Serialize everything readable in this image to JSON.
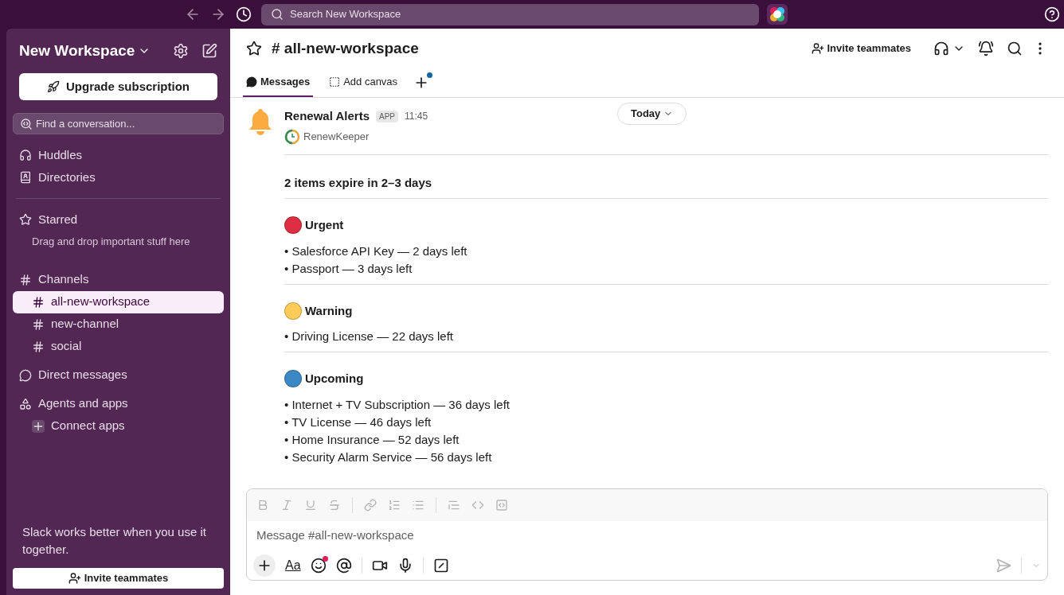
{
  "topbar": {
    "search_placeholder": "Search New Workspace"
  },
  "sidebar": {
    "workspace": "New Workspace",
    "upgrade_button": "Upgrade subscription",
    "search_placeholder": "Find a conversation...",
    "nav": [
      {
        "kind": "huddles",
        "label": "Huddles"
      },
      {
        "kind": "directories",
        "label": "Directories"
      }
    ],
    "starred": {
      "label": "Starred",
      "hint": "Drag and drop important stuff here"
    },
    "channels": {
      "label": "Channels",
      "items": [
        {
          "name": "all-new-workspace",
          "selected": true
        },
        {
          "name": "new-channel",
          "selected": false
        },
        {
          "name": "social",
          "selected": false
        }
      ]
    },
    "direct_messages": "Direct messages",
    "agents": {
      "label": "Agents and apps",
      "connect": "Connect apps"
    },
    "footer_text": "Slack works better when you use it together.",
    "invite_button": "Invite teammates"
  },
  "header": {
    "title": "# all-new-workspace",
    "invite_button": "Invite teammates",
    "tabs": [
      {
        "kind": "messages",
        "label": "Messages",
        "selected": true
      },
      {
        "kind": "canvas",
        "label": "Add canvas",
        "selected": false
      }
    ]
  },
  "date_pill": "Today",
  "message": {
    "sender": "Renewal Alerts",
    "badge": "APP",
    "time": "11:45",
    "app_name": "RenewKeeper",
    "heading": "2 items expire in 2–3 days",
    "groups": [
      {
        "title": "Urgent",
        "color": "#dd2e44",
        "items": [
          "• Salesforce API Key — 2 days left",
          "• Passport — 3 days left"
        ]
      },
      {
        "title": "Warning",
        "color": "#fdcb58",
        "items": [
          "• Driving License — 22 days left"
        ]
      },
      {
        "title": "Upcoming",
        "color": "#3b88c3",
        "items": [
          "• Internet + TV Subscription — 36 days left",
          "• TV License — 46 days left",
          "• Home Insurance — 52 days left",
          "• Security Alarm Service — 56 days left"
        ]
      }
    ]
  },
  "composer": {
    "placeholder": "Message #all-new-workspace",
    "format_label": "Aa"
  }
}
